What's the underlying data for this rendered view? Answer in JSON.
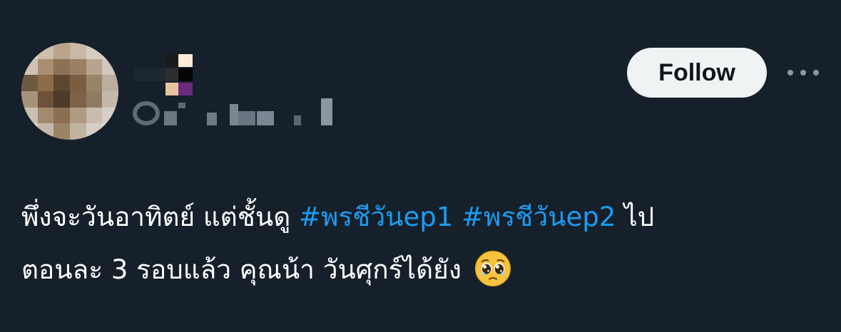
{
  "header": {
    "follow_label": "Follow",
    "more_icon": "more-horizontal-icon"
  },
  "tweet": {
    "line1_text": "พึ่งจะวันอาทิตย์ แต่ชั้นดู ",
    "hashtag1": "#พรชีวันep1",
    "hashtag2": "#พรชีวันep2",
    "line1_tail": " ไป",
    "line2_text": "ตอนละ 3 รอบแล้ว คุณน้า วันศุกร์ได้ยัง",
    "emoji_name": "pleading-face-emoji"
  },
  "colors": {
    "background": "#15202b",
    "text": "#ffffff",
    "hashtag": "#1d9bf0",
    "button_bg": "#eff3f4",
    "button_text": "#0f1419",
    "muted": "#8b98a5"
  }
}
